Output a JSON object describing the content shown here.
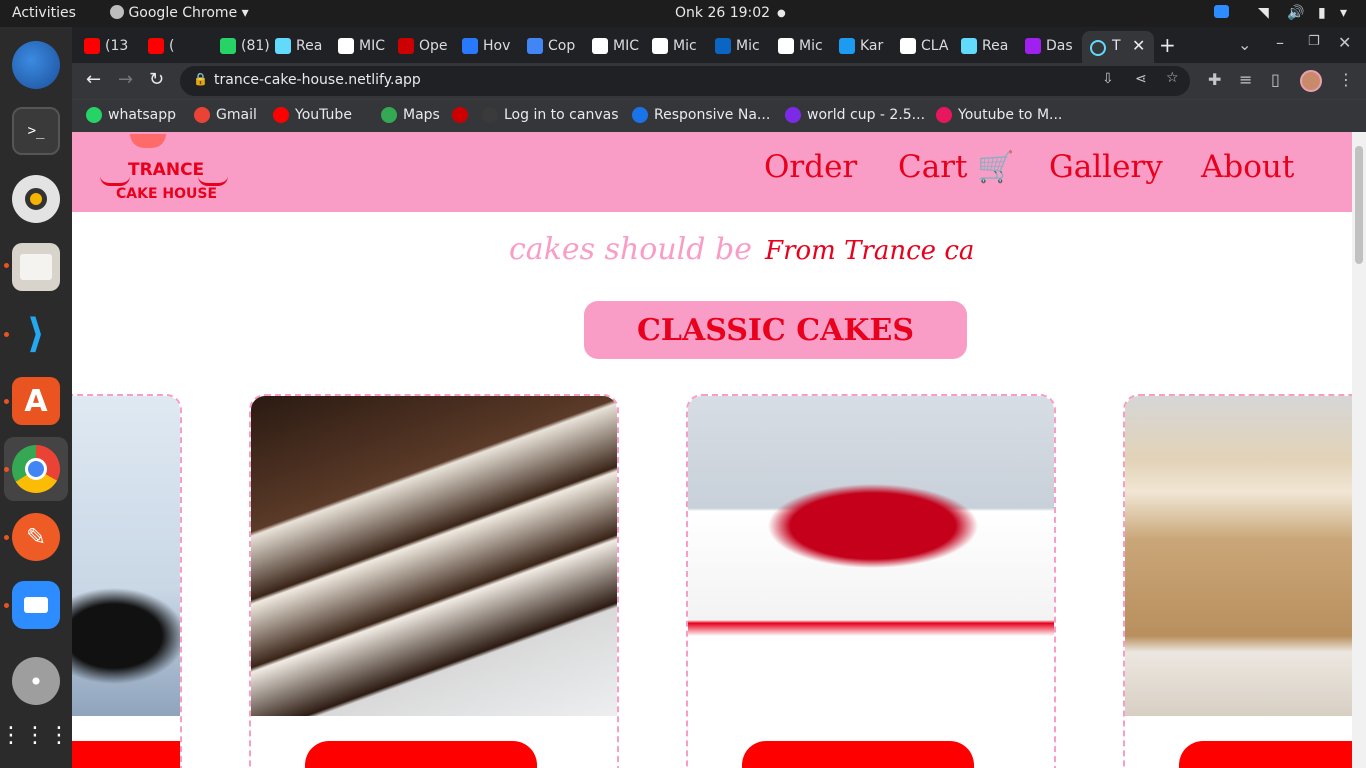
{
  "topbar": {
    "activities": "Activities",
    "app_name": "Google Chrome",
    "clock": "Onk 26  19:02"
  },
  "browser": {
    "tabs": [
      {
        "label": "(13",
        "icon": "youtube-icon",
        "color": "#ff0000"
      },
      {
        "label": "(",
        "icon": "youtube-icon",
        "color": "#ff0000"
      },
      {
        "label": "(81)",
        "icon": "whatsapp-icon",
        "color": "#25d366"
      },
      {
        "label": "Rea",
        "icon": "react-icon",
        "color": "#61dafb"
      },
      {
        "label": "MIC",
        "icon": "github-icon",
        "color": "#ffffff"
      },
      {
        "label": "Ope",
        "icon": "openai-icon",
        "color": "#cc0000"
      },
      {
        "label": "Hov",
        "icon": "hover-icon",
        "color": "#2979ff"
      },
      {
        "label": "Cop",
        "icon": "docs-icon",
        "color": "#4285f4"
      },
      {
        "label": "MIC",
        "icon": "github-icon",
        "color": "#ffffff"
      },
      {
        "label": "Mic",
        "icon": "globe-icon",
        "color": "#ffffff"
      },
      {
        "label": "Mic",
        "icon": "linkedin-icon",
        "color": "#0a66c2"
      },
      {
        "label": "Mic",
        "icon": "hand-icon",
        "color": "#ffffff"
      },
      {
        "label": "Kar",
        "icon": "twitter-icon",
        "color": "#1d9bf0"
      },
      {
        "label": "CLA",
        "icon": "medium-icon",
        "color": "#ffffff"
      },
      {
        "label": "Rea",
        "icon": "react-icon",
        "color": "#61dafb"
      },
      {
        "label": "Das",
        "icon": "dashboard-icon",
        "color": "#a020f0"
      }
    ],
    "active_tab_label": "T",
    "url": "trance-cake-house.netlify.app",
    "bookmarks": [
      {
        "label": "whatsapp",
        "icon": "whatsapp-icon",
        "color": "#25d366"
      },
      {
        "label": "Gmail",
        "icon": "gmail-icon",
        "color": "#ea4335"
      },
      {
        "label": "YouTube",
        "icon": "youtube-icon",
        "color": "#ff0000"
      },
      {
        "label": "Maps",
        "icon": "maps-icon",
        "color": "#34a853"
      },
      {
        "label": "",
        "icon": "flag-icon",
        "color": "#cc0000"
      },
      {
        "label": "Log in to canvas",
        "icon": "canvas-icon",
        "color": "#3a3a3a"
      },
      {
        "label": "Responsive Na...",
        "icon": "codingninjas-icon",
        "color": "#1a73e8"
      },
      {
        "label": "world cup - 2.5...",
        "icon": "canva-icon",
        "color": "#7d2ae8"
      },
      {
        "label": "Youtube to M...",
        "icon": "download-icon",
        "color": "#e8175d"
      }
    ]
  },
  "site": {
    "logo_line1": "TRANCE",
    "logo_line2": "CAKE HOUSE",
    "nav": [
      "Order",
      "Cart",
      "Gallery",
      "About"
    ],
    "tagline_left": "cakes should be",
    "tagline_right": "From Trance ca",
    "section_title": "CLASSIC CAKES",
    "cards": [
      {
        "name": "oreo-cake"
      },
      {
        "name": "marble-chocolate-cake"
      },
      {
        "name": "red-drip-cake"
      },
      {
        "name": "caramel-drip-cake"
      }
    ]
  },
  "colors": {
    "brand_pink": "#f99dc6",
    "brand_red": "#e8001c",
    "button_red": "#ff0000"
  }
}
